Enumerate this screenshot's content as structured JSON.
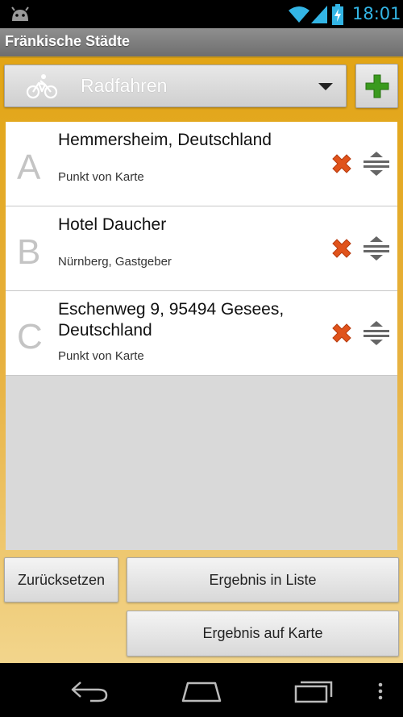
{
  "status": {
    "time": "18:01"
  },
  "app": {
    "title": "Fränkische Städte"
  },
  "mode": {
    "label": "Radfahren",
    "icon": "bicycle-icon"
  },
  "stops": [
    {
      "letter": "A",
      "name": "Hemmersheim, Deutschland",
      "detail": "Punkt von Karte"
    },
    {
      "letter": "B",
      "name": "Hotel Daucher",
      "detail": "Nürnberg, Gastgeber"
    },
    {
      "letter": "C",
      "name": "Eschenweg 9, 95494 Gesees, Deutschland",
      "detail": "Punkt von Karte"
    }
  ],
  "actions": {
    "reset": "Zurücksetzen",
    "result_list": "Ergebnis in Liste",
    "result_map": "Ergebnis auf Karte"
  },
  "colors": {
    "accent": "#e2a515",
    "clock": "#33b5e5",
    "delete": "#e0531b",
    "add": "#3a9a1e"
  }
}
